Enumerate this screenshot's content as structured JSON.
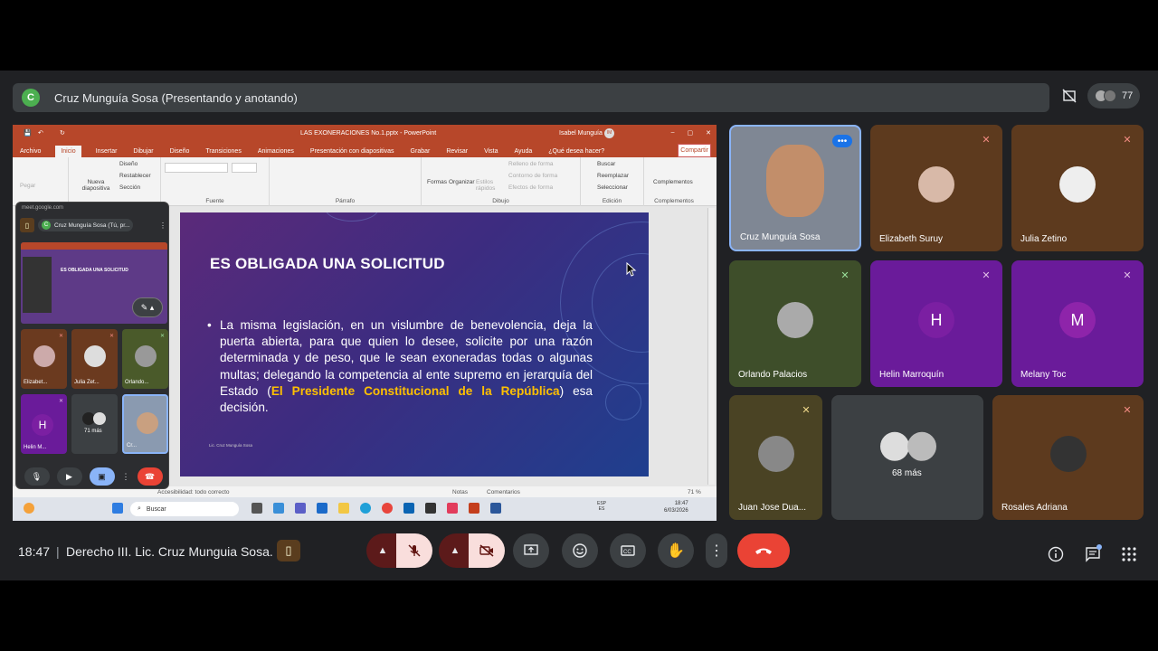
{
  "header": {
    "presenter_initial": "C",
    "presenter_title": "Cruz Munguía Sosa (Presentando y anotando)",
    "participant_count": "77"
  },
  "powerpoint": {
    "doc_title": "LAS EXONERACIONES No.1.pptx - PowerPoint",
    "user": "Isabel Munguía",
    "user_initials": "IM",
    "tabs": [
      "Archivo",
      "Inicio",
      "Insertar",
      "Dibujar",
      "Diseño",
      "Transiciones",
      "Animaciones",
      "Presentación con diapositivas",
      "Grabar",
      "Revisar",
      "Vista",
      "Ayuda",
      "¿Qué desea hacer?"
    ],
    "share_label": "Compartir",
    "ribbon": {
      "paste": "Pegar",
      "new_slide": "Nueva diapositiva",
      "layout": "Diseño",
      "reset": "Restablecer",
      "section": "Sección",
      "font_group": "Fuente",
      "paragraph_group": "Párrafo",
      "shapes": "Formas",
      "arrange": "Organizar",
      "quick_styles": "Estilos rápidos",
      "shape_fill": "Relleno de forma",
      "shape_outline": "Contorno de forma",
      "shape_effects": "Efectos de forma",
      "drawing_group": "Dibujo",
      "find": "Buscar",
      "replace": "Reemplazar",
      "select": "Seleccionar",
      "editing_group": "Edición",
      "addins": "Complementos",
      "addins_group": "Complementos"
    },
    "slide": {
      "title": "ES OBLIGADA UNA SOLICITUD",
      "bullet_char": "•",
      "body_text": "La misma legislación, en un vislumbre de benevolencia, deja la puerta abierta, para que quien lo desee, solicite por una razón determinada y de peso, que le sean exoneradas todas o algunas multas; delegando la competencia al ente supremo en jerarquía del Estado (",
      "body_highlight": "El Presidente Constitucional de la República",
      "body_tail": ") esa decisión.",
      "footer": "Lic. Cruz Munguía Sosa"
    },
    "status": {
      "accessibility": "Accesibilidad: todo correcto",
      "notes": "Notas",
      "comments": "Comentarios",
      "zoom": "71 %"
    },
    "taskbar": {
      "search_placeholder": "Buscar",
      "lang": "ESP",
      "lang2": "ES",
      "time": "18:47",
      "date": "6/03/2026"
    }
  },
  "mini_meet": {
    "url": "meet.google.com",
    "presenter_chip": "Cruz Munguía Sosa (Tú, pr...",
    "thumb_title": "ES OBLIGADA UNA SOLICITUD",
    "tiles": [
      {
        "name": "Elizabet..."
      },
      {
        "name": "Julia Zet..."
      },
      {
        "name": "Orlando..."
      },
      {
        "name": "Helin M...",
        "letter": "H"
      },
      {
        "name": "71 más"
      },
      {
        "name": "Cr..."
      }
    ]
  },
  "tiles": [
    {
      "name": "Cruz Munguía Sosa"
    },
    {
      "name": "Elizabeth Suruy"
    },
    {
      "name": "Julia Zetino"
    },
    {
      "name": "Orlando Palacios"
    },
    {
      "name": "Helin Marroquín",
      "letter": "H"
    },
    {
      "name": "Melany Toc",
      "letter": "M"
    },
    {
      "name": "Juan Jose Dua..."
    },
    {
      "name": "68 más"
    },
    {
      "name": "Rosales Adriana"
    }
  ],
  "bottom": {
    "time": "18:47",
    "separator": "|",
    "meeting_title": "Derecho III. Lic. Cruz Munguia Sosa."
  },
  "colors": {
    "hangup": "#ea4335",
    "muted_bg": "#f9dedc",
    "accent_blue": "#8ab4f8",
    "ppt_red": "#b7472a",
    "highlight_yellow": "#ffc000"
  }
}
